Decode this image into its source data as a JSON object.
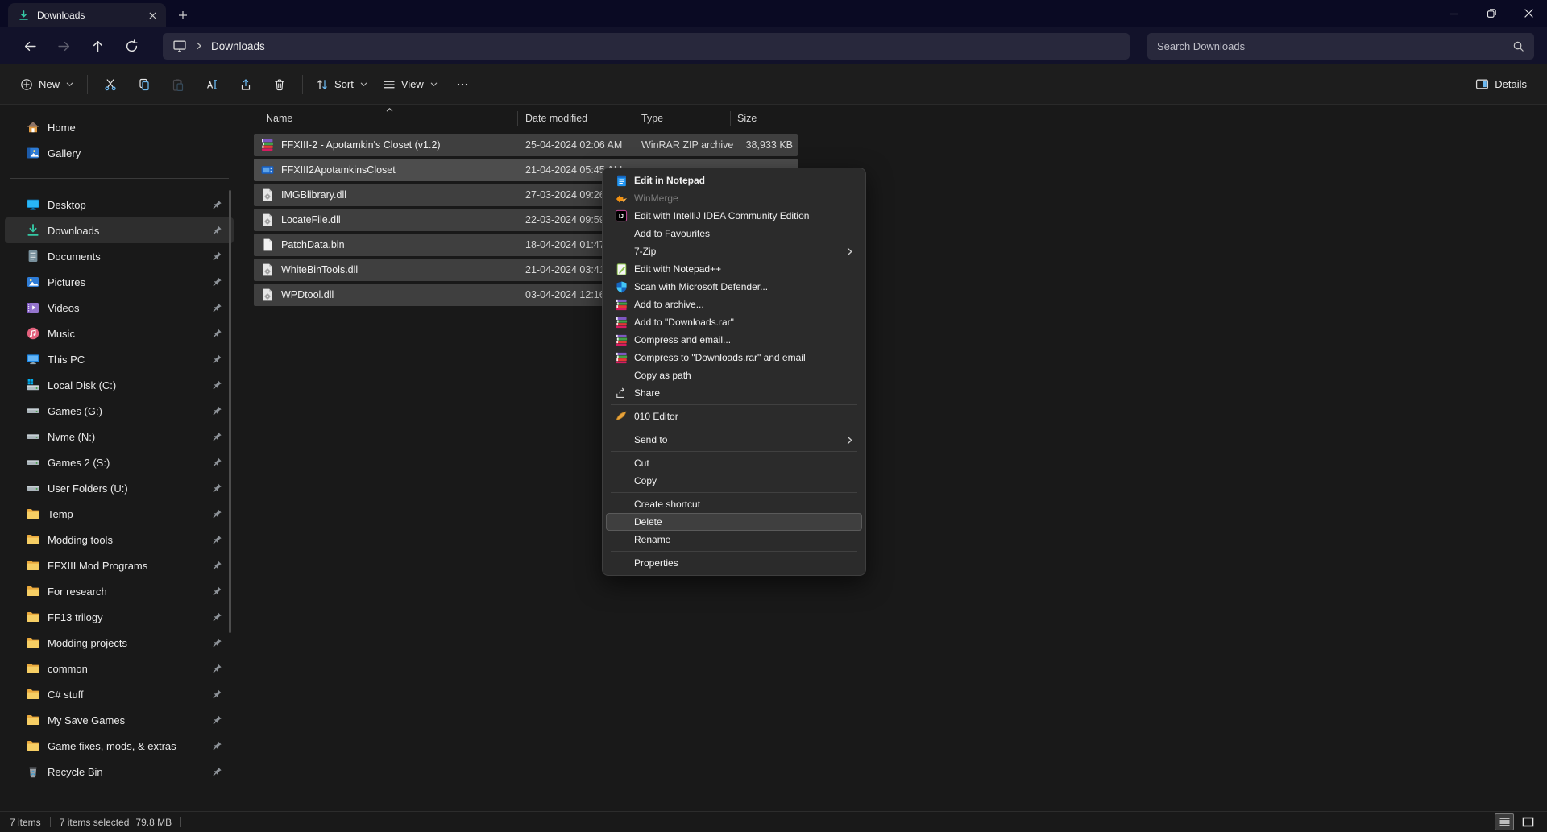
{
  "window": {
    "tab": {
      "label": "Downloads",
      "icon": "download-icon"
    },
    "controls": {
      "minimize": "minimize",
      "restore": "restore",
      "close": "close"
    }
  },
  "address_bar": {
    "path": "Downloads",
    "search_placeholder": "Search Downloads"
  },
  "toolbar": {
    "new_label": "New",
    "sort_label": "Sort",
    "view_label": "View",
    "details_label": "Details",
    "buttons": [
      {
        "icon": "cut-icon",
        "disabled": false
      },
      {
        "icon": "copy-icon",
        "disabled": false
      },
      {
        "icon": "paste-icon",
        "disabled": true
      },
      {
        "icon": "rename-icon",
        "disabled": false
      },
      {
        "icon": "share-icon",
        "disabled": false
      },
      {
        "icon": "delete-icon",
        "disabled": false
      }
    ]
  },
  "sidebar": {
    "items": [
      {
        "type": "item",
        "icon": "home-icon",
        "label": "Home",
        "pinned": false,
        "selected": false
      },
      {
        "type": "item",
        "icon": "gallery-icon",
        "label": "Gallery",
        "pinned": false,
        "selected": false
      },
      {
        "type": "separator"
      },
      {
        "type": "item",
        "icon": "desktop-icon",
        "label": "Desktop",
        "pinned": true,
        "selected": false
      },
      {
        "type": "item",
        "icon": "downloads-icon",
        "label": "Downloads",
        "pinned": true,
        "selected": true
      },
      {
        "type": "item",
        "icon": "documents-icon",
        "label": "Documents",
        "pinned": true,
        "selected": false
      },
      {
        "type": "item",
        "icon": "pictures-icon",
        "label": "Pictures",
        "pinned": true,
        "selected": false
      },
      {
        "type": "item",
        "icon": "videos-icon",
        "label": "Videos",
        "pinned": true,
        "selected": false
      },
      {
        "type": "item",
        "icon": "music-icon",
        "label": "Music",
        "pinned": true,
        "selected": false
      },
      {
        "type": "item",
        "icon": "this-pc-icon",
        "label": "This PC",
        "pinned": true,
        "selected": false
      },
      {
        "type": "item",
        "icon": "local-disk-icon",
        "label": "Local Disk (C:)",
        "pinned": true,
        "selected": false
      },
      {
        "type": "item",
        "icon": "drive-icon",
        "label": "Games (G:)",
        "pinned": true,
        "selected": false
      },
      {
        "type": "item",
        "icon": "drive-icon",
        "label": "Nvme (N:)",
        "pinned": true,
        "selected": false
      },
      {
        "type": "item",
        "icon": "drive-icon",
        "label": "Games 2 (S:)",
        "pinned": true,
        "selected": false
      },
      {
        "type": "item",
        "icon": "drive-icon",
        "label": "User Folders (U:)",
        "pinned": true,
        "selected": false
      },
      {
        "type": "item",
        "icon": "folder-icon",
        "label": "Temp",
        "pinned": true,
        "selected": false
      },
      {
        "type": "item",
        "icon": "folder-icon",
        "label": "Modding tools",
        "pinned": true,
        "selected": false
      },
      {
        "type": "item",
        "icon": "folder-icon",
        "label": "FFXIII Mod Programs",
        "pinned": true,
        "selected": false
      },
      {
        "type": "item",
        "icon": "folder-icon",
        "label": "For research",
        "pinned": true,
        "selected": false
      },
      {
        "type": "item",
        "icon": "folder-icon",
        "label": "FF13 trilogy",
        "pinned": true,
        "selected": false
      },
      {
        "type": "item",
        "icon": "folder-icon",
        "label": "Modding projects",
        "pinned": true,
        "selected": false
      },
      {
        "type": "item",
        "icon": "folder-icon",
        "label": "common",
        "pinned": true,
        "selected": false
      },
      {
        "type": "item",
        "icon": "folder-icon",
        "label": "C# stuff",
        "pinned": true,
        "selected": false
      },
      {
        "type": "item",
        "icon": "folder-icon",
        "label": "My Save Games",
        "pinned": true,
        "selected": false
      },
      {
        "type": "item",
        "icon": "folder-icon",
        "label": "Game fixes, mods, & extras",
        "pinned": true,
        "selected": false
      },
      {
        "type": "item",
        "icon": "recycle-bin-icon",
        "label": "Recycle Bin",
        "pinned": true,
        "selected": false
      },
      {
        "type": "separator"
      }
    ]
  },
  "files": {
    "columns": [
      {
        "label": "Name",
        "sorted": "asc"
      },
      {
        "label": "Date modified"
      },
      {
        "label": "Type"
      },
      {
        "label": "Size"
      }
    ],
    "rows": [
      {
        "icon": "winrar-archive-icon",
        "name": "FFXIII-2 - Apotamkin's Closet (v1.2)",
        "date": "25-04-2024 02:06 AM",
        "type": "WinRAR ZIP archive",
        "size": "38,933 KB",
        "em": false
      },
      {
        "icon": "app-icon",
        "name": "FFXIII2ApotamkinsCloset",
        "date": "21-04-2024 05:45 AM",
        "type": "",
        "size": "",
        "em": true
      },
      {
        "icon": "dll-icon",
        "name": "IMGBlibrary.dll",
        "date": "27-03-2024 09:26 PM",
        "type": "",
        "size": "",
        "em": false
      },
      {
        "icon": "dll-icon",
        "name": "LocateFile.dll",
        "date": "22-03-2024 09:59 PM",
        "type": "",
        "size": "",
        "em": false
      },
      {
        "icon": "bin-file-icon",
        "name": "PatchData.bin",
        "date": "18-04-2024 01:47 PM",
        "type": "",
        "size": "",
        "em": false
      },
      {
        "icon": "dll-icon",
        "name": "WhiteBinTools.dll",
        "date": "21-04-2024 03:41 AM",
        "type": "",
        "size": "",
        "em": false
      },
      {
        "icon": "dll-icon",
        "name": "WPDtool.dll",
        "date": "03-04-2024 12:16 AM",
        "type": "",
        "size": "",
        "em": false
      }
    ]
  },
  "context_menu": {
    "items": [
      {
        "type": "item",
        "icon": "notepad-icon",
        "label": "Edit in Notepad",
        "bold": true
      },
      {
        "type": "item",
        "icon": "winmerge-icon",
        "label": "WinMerge",
        "disabled": true
      },
      {
        "type": "item",
        "icon": "intellij-icon",
        "label": "Edit with IntelliJ IDEA Community Edition"
      },
      {
        "type": "item",
        "label": "Add to Favourites"
      },
      {
        "type": "item",
        "label": "7-Zip",
        "submenu": true
      },
      {
        "type": "item",
        "icon": "notepadpp-icon",
        "label": "Edit with Notepad++"
      },
      {
        "type": "item",
        "icon": "defender-icon",
        "label": "Scan with Microsoft Defender..."
      },
      {
        "type": "item",
        "icon": "winrar-icon",
        "label": "Add to archive..."
      },
      {
        "type": "item",
        "icon": "winrar-icon",
        "label": "Add to \"Downloads.rar\""
      },
      {
        "type": "item",
        "icon": "winrar-icon",
        "label": "Compress and email..."
      },
      {
        "type": "item",
        "icon": "winrar-icon",
        "label": "Compress to \"Downloads.rar\" and email"
      },
      {
        "type": "item",
        "label": "Copy as path"
      },
      {
        "type": "item",
        "icon": "share-menu-icon",
        "label": "Share"
      },
      {
        "type": "separator"
      },
      {
        "type": "item",
        "icon": "editor010-icon",
        "label": "010 Editor"
      },
      {
        "type": "separator"
      },
      {
        "type": "item",
        "label": "Send to",
        "submenu": true
      },
      {
        "type": "separator"
      },
      {
        "type": "item",
        "label": "Cut"
      },
      {
        "type": "item",
        "label": "Copy"
      },
      {
        "type": "separator"
      },
      {
        "type": "item",
        "label": "Create shortcut"
      },
      {
        "type": "item",
        "label": "Delete",
        "highlighted": true
      },
      {
        "type": "item",
        "label": "Rename"
      },
      {
        "type": "separator"
      },
      {
        "type": "item",
        "label": "Properties"
      }
    ]
  },
  "status_bar": {
    "items_count": "7 items",
    "selection": "7 items selected",
    "selection_size": "79.8 MB"
  },
  "colors": {
    "titlebar": "#0a0a23",
    "accent_blue": "#6cb8f0",
    "downloads_teal": "#35c7a4",
    "selection_gray": "#3f3f3f",
    "folder_yellow": "#f6ce64",
    "menu_bg": "#2b2b2b"
  }
}
